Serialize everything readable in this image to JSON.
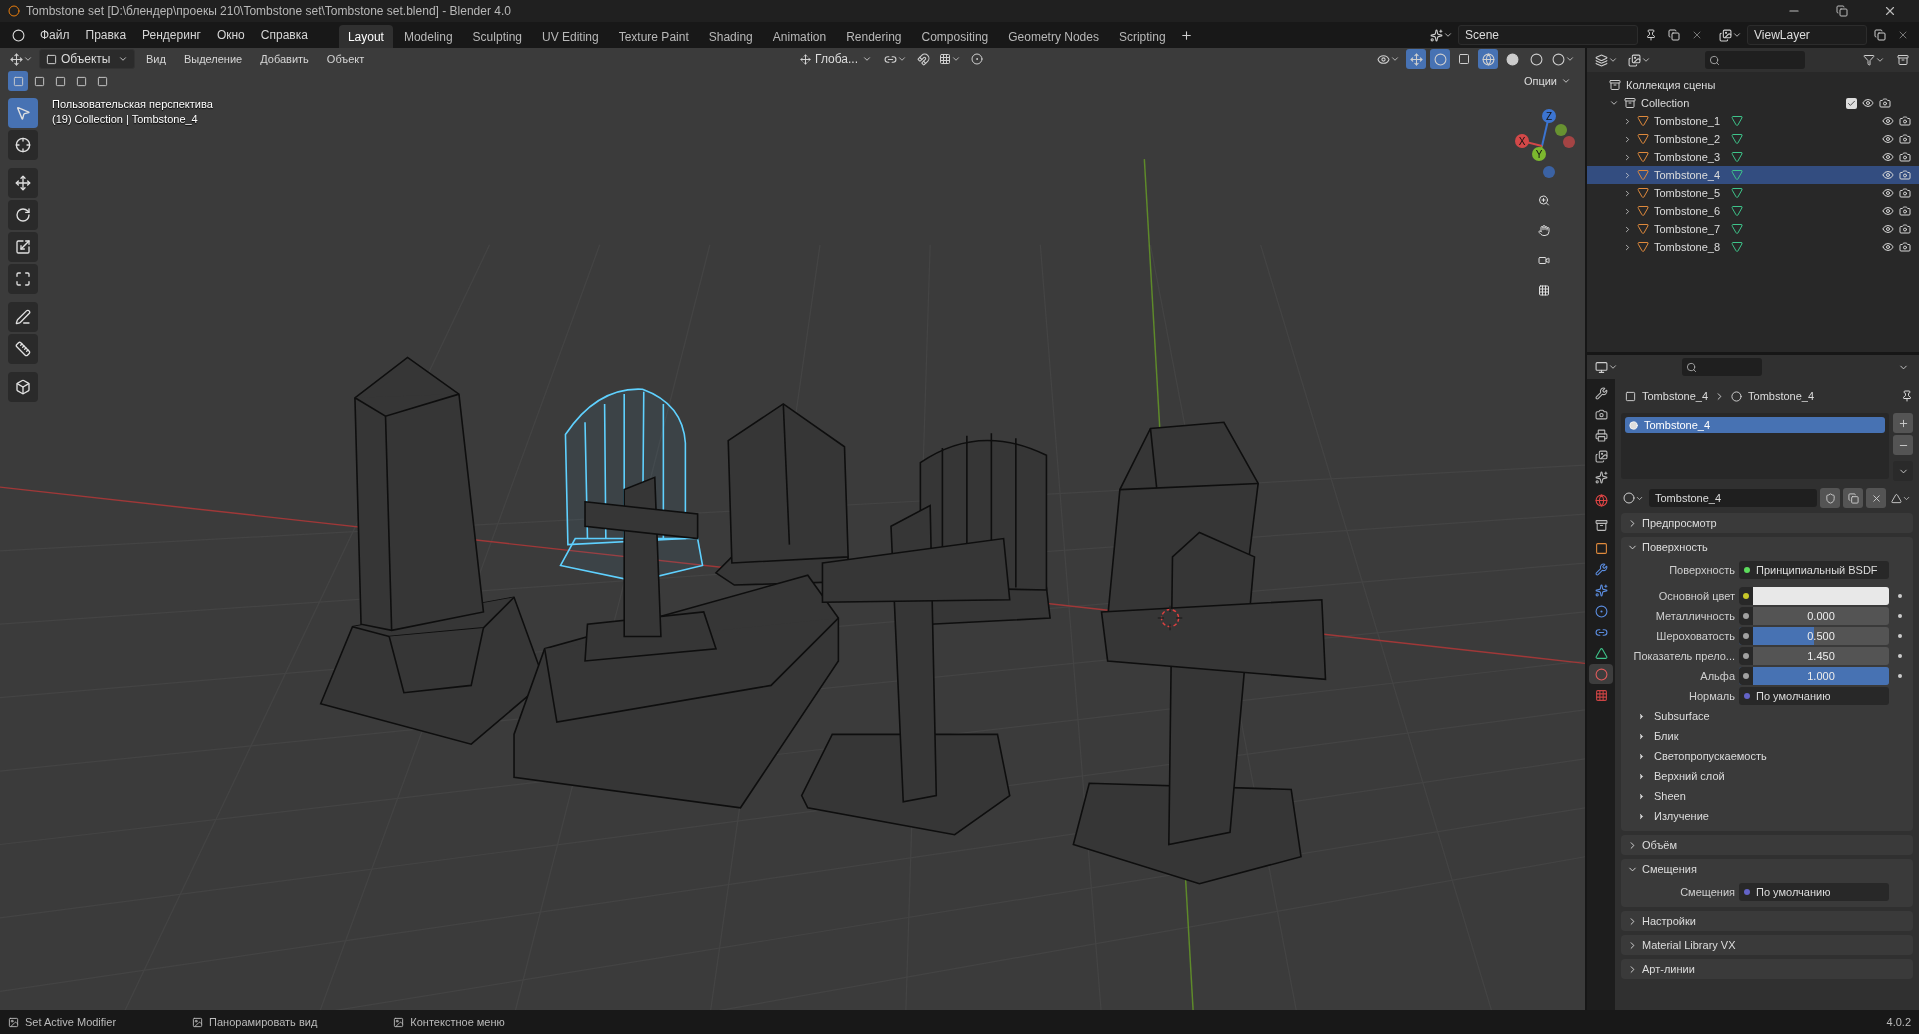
{
  "window": {
    "title": "Tombstone set [D:\\блендер\\проекы 210\\Tombstone set\\Tombstone set.blend] - Blender 4.0"
  },
  "menu": [
    "Файл",
    "Правка",
    "Рендеринг",
    "Окно",
    "Справка"
  ],
  "workspaces": [
    {
      "label": "Layout",
      "selected": true
    },
    {
      "label": "Modeling",
      "selected": false
    },
    {
      "label": "Sculpting",
      "selected": false
    },
    {
      "label": "UV Editing",
      "selected": false
    },
    {
      "label": "Texture Paint",
      "selected": false
    },
    {
      "label": "Shading",
      "selected": false
    },
    {
      "label": "Animation",
      "selected": false
    },
    {
      "label": "Rendering",
      "selected": false
    },
    {
      "label": "Compositing",
      "selected": false
    },
    {
      "label": "Geometry Nodes",
      "selected": false
    },
    {
      "label": "Scripting",
      "selected": false
    }
  ],
  "scene": {
    "name": "Scene"
  },
  "view_layer": {
    "name": "ViewLayer"
  },
  "viewport": {
    "mode": "Объекты",
    "menus": [
      "Вид",
      "Выделение",
      "Добавить",
      "Объект"
    ],
    "orientation": "Глоба...",
    "options": "Опции",
    "overlay_text": [
      "Пользовательская перспектива",
      "(19) Collection | Tombstone_4"
    ],
    "tools": [
      {
        "kind": "select",
        "selected": true
      },
      {
        "kind": "cursor",
        "selected": false
      },
      {
        "kind": "move",
        "selected": false
      },
      {
        "kind": "rotate",
        "selected": false
      },
      {
        "kind": "scale",
        "selected": false
      },
      {
        "kind": "transform",
        "selected": false
      },
      {
        "kind": "annotate",
        "selected": false
      },
      {
        "kind": "measure",
        "selected": false
      },
      {
        "kind": "add-cube",
        "selected": false
      }
    ],
    "gizmo": {
      "x": "X",
      "y": "Y",
      "z": "Z"
    },
    "objects": [
      {
        "kind": "obelisk",
        "selected": false
      },
      {
        "kind": "arch",
        "selected": true
      },
      {
        "kind": "grave",
        "selected": false
      },
      {
        "kind": "pointed",
        "selected": false
      },
      {
        "kind": "rounded",
        "selected": false
      },
      {
        "kind": "cross",
        "selected": false
      },
      {
        "kind": "pentagon",
        "selected": false
      },
      {
        "kind": "big-cross",
        "selected": false
      }
    ]
  },
  "outliner": {
    "root": "Коллекция сцены",
    "collection": {
      "name": "Collection",
      "expanded": true,
      "checked": true,
      "children": [
        {
          "name": "Tombstone_1",
          "selected": false
        },
        {
          "name": "Tombstone_2",
          "selected": false
        },
        {
          "name": "Tombstone_3",
          "selected": false
        },
        {
          "name": "Tombstone_4",
          "selected": true
        },
        {
          "name": "Tombstone_5",
          "selected": false
        },
        {
          "name": "Tombstone_6",
          "selected": false
        },
        {
          "name": "Tombstone_7",
          "selected": false
        },
        {
          "name": "Tombstone_8",
          "selected": false
        }
      ]
    }
  },
  "properties": {
    "tabs": [
      {
        "kind": "tool",
        "selected": false
      },
      {
        "kind": "render",
        "selected": false
      },
      {
        "kind": "output",
        "selected": false
      },
      {
        "kind": "view-layer",
        "selected": false
      },
      {
        "kind": "scene",
        "selected": false
      },
      {
        "kind": "world",
        "selected": false
      },
      {
        "kind": "collection",
        "selected": false
      },
      {
        "kind": "object",
        "selected": false
      },
      {
        "kind": "modifiers",
        "selected": false
      },
      {
        "kind": "particles",
        "selected": false
      },
      {
        "kind": "physics",
        "selected": false
      },
      {
        "kind": "constraints",
        "selected": false
      },
      {
        "kind": "data",
        "selected": false
      },
      {
        "kind": "material",
        "selected": true
      },
      {
        "kind": "texture",
        "selected": false
      }
    ],
    "breadcrumb": [
      "Tombstone_4",
      "Tombstone_4"
    ],
    "slots": [
      {
        "name": "Tombstone_4",
        "selected": true
      }
    ],
    "material": "Tombstone_4",
    "panels": [
      {
        "title": "Предпросмотр",
        "expanded": false
      },
      {
        "title": "Поверхность",
        "expanded": true,
        "rows": [
          {
            "kind": "link",
            "label": "Поверхность",
            "value": "Принципиальный BSDF",
            "color": "#5ddc5d"
          },
          {
            "kind": "color",
            "label": "Основной цвет",
            "color": "#c7c729"
          },
          {
            "kind": "slider",
            "label": "Металличность",
            "value": "0.000",
            "level": 0,
            "color": "#a1a1a1"
          },
          {
            "kind": "slider",
            "label": "Шероховатость",
            "value": "0.500",
            "level": 0.5,
            "color": "#a1a1a1"
          },
          {
            "kind": "number",
            "label": "Показатель прело...",
            "value": "1.450",
            "color": "#a1a1a1"
          },
          {
            "kind": "slider",
            "label": "Альфа",
            "value": "1.000",
            "level": 1,
            "color": "#a1a1a1"
          },
          {
            "kind": "link",
            "label": "Нормаль",
            "value": "По умолчанию",
            "color": "#6363c7"
          }
        ],
        "subpanels": [
          {
            "title": "Subsurface",
            "expanded": false
          },
          {
            "title": "Блик",
            "expanded": false
          },
          {
            "title": "Светопропускаемость",
            "expanded": false
          },
          {
            "title": "Верхний слой",
            "expanded": false
          },
          {
            "title": "Sheen",
            "expanded": false
          },
          {
            "title": "Излучение",
            "expanded": false
          }
        ]
      },
      {
        "title": "Объём",
        "expanded": false
      },
      {
        "title": "Смещения",
        "expanded": true,
        "rows": [
          {
            "kind": "link",
            "label": "Смещения",
            "value": "По умолчанию",
            "color": "#6363c7"
          }
        ]
      },
      {
        "title": "Настройки",
        "expanded": false
      },
      {
        "title": "Material Library VX",
        "expanded": false
      },
      {
        "title": "Арт-линии",
        "expanded": false
      }
    ]
  },
  "status_bar": {
    "hints": [
      "Set Active Modifier",
      "Панорамировать вид",
      "Контекстное меню"
    ],
    "version": "4.0.2"
  }
}
